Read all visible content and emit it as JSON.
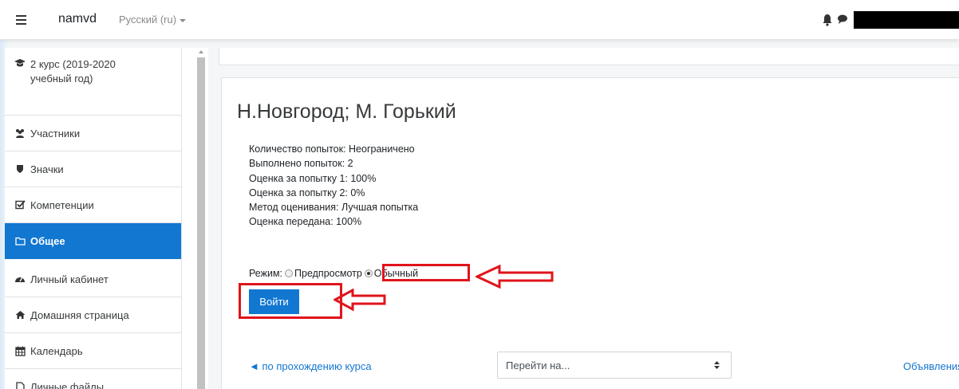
{
  "navbar": {
    "brand": "namvd",
    "language": "Русский (ru)",
    "icons": [
      "menu-icon",
      "bell-icon",
      "chat-icon"
    ]
  },
  "sidebar": {
    "items": [
      {
        "label": "2 курс (2019-2020\nучебный год)",
        "icon": "graduation-cap-icon"
      },
      {
        "label": "Участники",
        "icon": "users-icon"
      },
      {
        "label": "Значки",
        "icon": "shield-icon"
      },
      {
        "label": "Компетенции",
        "icon": "checkbox-icon"
      },
      {
        "label": "Общее",
        "icon": "folder-icon",
        "active": true
      },
      {
        "label": "Личный кабинет",
        "icon": "dashboard-icon"
      },
      {
        "label": "Домашняя страница",
        "icon": "home-icon"
      },
      {
        "label": "Календарь",
        "icon": "calendar-icon"
      },
      {
        "label": "Личные файлы",
        "icon": "file-icon"
      }
    ]
  },
  "main": {
    "title": "Н.Новгород; М. Горький",
    "info": [
      "Количество попыток: Неограничено",
      "Выполнено попыток: 2",
      "Оценка за попытку 1: 100%",
      "Оценка за попытку 2: 0%",
      "Метод оценивания: Лучшая попытка",
      "Оценка передана: 100%"
    ],
    "mode_label": "Режим:",
    "mode_options": [
      {
        "label": "Предпросмотр",
        "checked": false
      },
      {
        "label": "Обычный",
        "checked": true
      }
    ],
    "enter_button": "Войти",
    "annotation_color": "#e0141b"
  },
  "footer_nav": {
    "prev_link": "◄ по прохождению курса",
    "jump_placeholder": "Перейти на...",
    "next_link": "Объявления"
  },
  "colors": {
    "accent": "#1177d1"
  }
}
